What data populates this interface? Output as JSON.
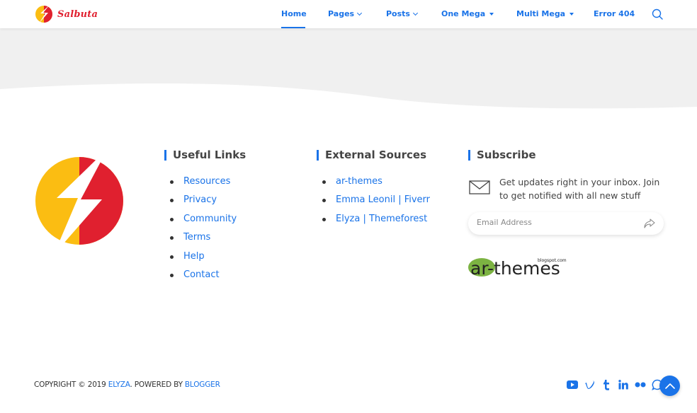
{
  "brand": {
    "name": "Salbuta"
  },
  "nav": {
    "items": [
      {
        "label": "Home",
        "caret": "none",
        "active": true
      },
      {
        "label": "Pages",
        "caret": "chevron"
      },
      {
        "label": "Posts",
        "caret": "chevron"
      },
      {
        "label": "One Mega",
        "caret": "triangle"
      },
      {
        "label": "Multi Mega",
        "caret": "triangle"
      },
      {
        "label": "Error 404",
        "caret": "none"
      }
    ],
    "search_icon": "search-icon"
  },
  "footer": {
    "useful_links": {
      "title": "Useful Links",
      "items": [
        "Resources",
        "Privacy",
        "Community",
        "Terms",
        "Help",
        "Contact"
      ]
    },
    "external_sources": {
      "title": "External Sources",
      "items": [
        "ar-themes",
        "Emma Leonil | Fiverr",
        "Elyza | Themeforest"
      ]
    },
    "subscribe": {
      "title": "Subscribe",
      "text": "Get updates right in your inbox. Join to get notified with all new stuff",
      "email_placeholder": "Email Address"
    },
    "partner_logo": {
      "main": "ar-themes",
      "sub": "blogspot.com"
    }
  },
  "bottom": {
    "copyright_prefix": "COPYRIGHT © 2019 ",
    "author": "ELYZA",
    "powered_by": ". POWERED BY ",
    "platform": "BLOGGER",
    "social": [
      "youtube-icon",
      "vimeo-icon",
      "tumblr-icon",
      "linkedin-icon",
      "flickr-icon",
      "whatsapp-icon"
    ]
  },
  "colors": {
    "accent": "#1a73e8",
    "brand_red": "#e0202f",
    "brand_yellow": "#fbbd12",
    "band_gray": "#f0f0f0"
  }
}
